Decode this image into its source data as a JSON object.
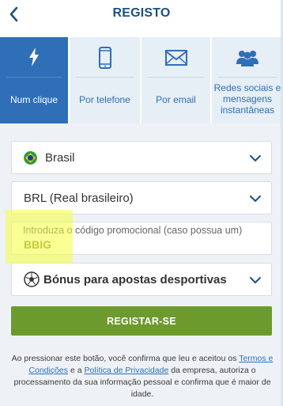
{
  "header": {
    "title": "REGISTO",
    "back_icon": "chevron-left-icon"
  },
  "tabs": [
    {
      "id": "one-click",
      "label": "Num clique",
      "icon": "lightning-icon",
      "active": true
    },
    {
      "id": "phone",
      "label": "Por telefone",
      "icon": "phone-icon",
      "active": false
    },
    {
      "id": "email",
      "label": "Por email",
      "icon": "envelope-icon",
      "active": false
    },
    {
      "id": "social",
      "label": "Redes sociais e mensagens instantâneas",
      "icon": "users-icon",
      "active": false
    }
  ],
  "form": {
    "country": {
      "value": "Brasil",
      "icon": "brazil-flag-icon"
    },
    "currency": {
      "value": "BRL (Real brasileiro)"
    },
    "promo": {
      "label": "Introduza o código promocional (caso possua um)",
      "value": "BBIG"
    },
    "bonus": {
      "value": "Bónus para apostas desportivas",
      "icon": "soccer-ball-icon"
    },
    "register_label": "REGISTAR-SE"
  },
  "legal": {
    "part1": "Ao pressionar este botão, você confirma que leu e aceitou os ",
    "terms_link": "Termos e Condições",
    "part2": " e a ",
    "privacy_link": "Política de Privacidade",
    "part3": " da empresa, autoriza o processamento da sua informação pessoal e confirma que é maior de idade."
  },
  "colors": {
    "header_text": "#1e4f80",
    "active_tab": "#2e6fb8",
    "inactive_tab": "#e6eef6",
    "register_button": "#6d9a2c",
    "link": "#2e6fb8",
    "highlight": "#f6ff3c"
  }
}
